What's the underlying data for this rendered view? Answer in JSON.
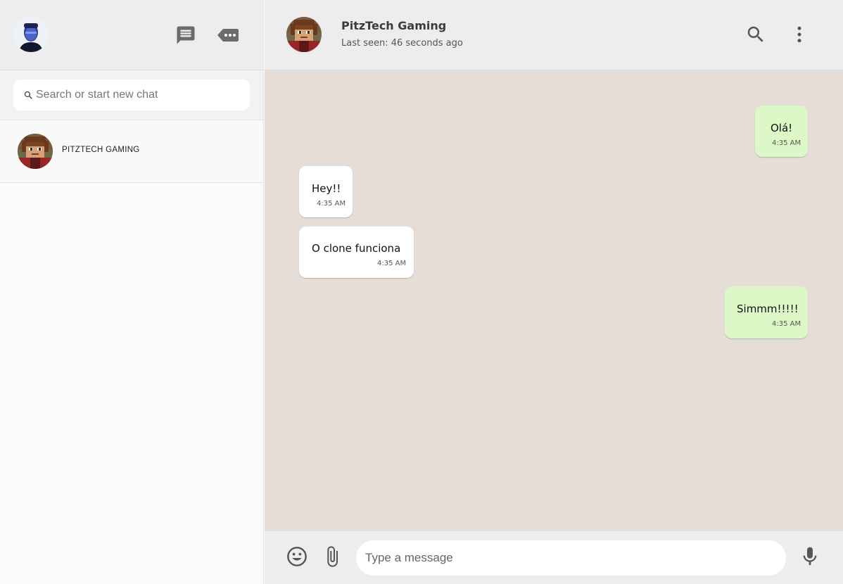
{
  "sidebar": {
    "user_avatar": "user-avatar",
    "icons": [
      "chat-icon",
      "more-chats-icon"
    ],
    "search": {
      "placeholder": "Search or start new chat",
      "value": ""
    },
    "chats": [
      {
        "name": "PITZTECH GAMING"
      }
    ]
  },
  "chat": {
    "contact_name": "PitzTech Gaming",
    "status": "Last seen: 46 seconds ago",
    "header_icons": [
      "search-icon",
      "menu-dots-icon"
    ],
    "messages": [
      {
        "direction": "out",
        "text": "Olá!",
        "time": "4:35 AM"
      },
      {
        "direction": "in",
        "text": "Hey!!",
        "time": "4:35 AM"
      },
      {
        "direction": "in",
        "text": "O clone funciona",
        "time": "4:35 AM"
      },
      {
        "direction": "out",
        "text": "Simmm!!!!!",
        "time": "4:35 AM"
      }
    ],
    "input": {
      "placeholder": "Type a message",
      "value": ""
    },
    "footer_icons": [
      "emoji-icon",
      "attach-icon",
      "mic-icon"
    ]
  },
  "colors": {
    "outgoing_bubble": "#dcf8c6",
    "incoming_bubble": "#ffffff",
    "chat_background": "#e5ddd6",
    "header_background": "#ededed"
  }
}
